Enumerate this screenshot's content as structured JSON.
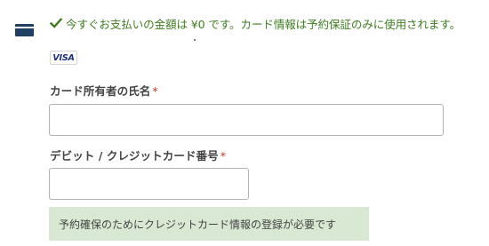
{
  "notice": {
    "text": "今すぐお支払いの金額は ¥0 です。カード情報は予約保証のみに使用されます。",
    "color": "#3f7d20",
    "icon": "check-icon"
  },
  "card_icon": "credit-card-icon",
  "card_brand": {
    "label": "VISA"
  },
  "fields": {
    "cardholder_name": {
      "label": "カード所有者の氏名",
      "required_mark": "*",
      "value": ""
    },
    "card_number": {
      "label": "デビット / クレジットカード番号",
      "required_mark": "*",
      "value": ""
    }
  },
  "info_box": {
    "text": "予約確保のためにクレジットカード情報の登録が必要です",
    "background": "#d8e8d2"
  }
}
